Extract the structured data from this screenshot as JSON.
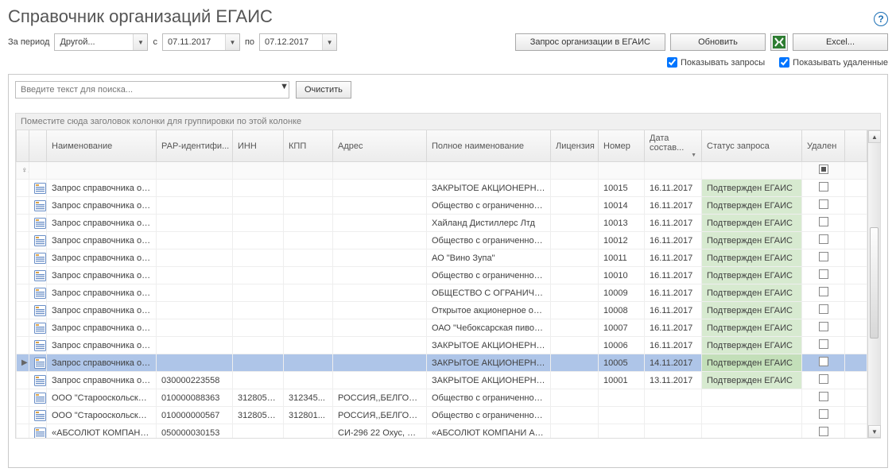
{
  "title": "Справочник организаций ЕГАИС",
  "period": {
    "label": "За период",
    "mode": "Другой...",
    "from_label": "с",
    "from": "07.11.2017",
    "to_label": "по",
    "to": "07.12.2017"
  },
  "buttons": {
    "request_org": "Запрос организации в ЕГАИС",
    "refresh": "Обновить",
    "excel": "Excel...",
    "clear": "Очистить"
  },
  "checks": {
    "show_requests": "Показывать запросы",
    "show_deleted": "Показывать удаленные"
  },
  "search_placeholder": "Введите текст для поиска...",
  "group_hint": "Поместите сюда заголовок колонки для группировки по этой колонке",
  "columns": {
    "name": "Наименование",
    "rar": "РАР-идентифи...",
    "inn": "ИНН",
    "kpp": "КПП",
    "address": "Адрес",
    "fullname": "Полное наименование",
    "license": "Лицензия",
    "number": "Номер",
    "date": "Дата состав...",
    "status": "Статус запроса",
    "deleted": "Удален"
  },
  "status_confirmed": "Подтвержден ЕГАИС",
  "rows": [
    {
      "sel": "",
      "name": "Запрос справочника ор...",
      "rar": "",
      "inn": "",
      "kpp": "",
      "addr": "",
      "full": "ЗАКРЫТОЕ АКЦИОНЕРНОЕ ...",
      "lic": "",
      "num": "10015",
      "date": "16.11.2017",
      "status": "ok",
      "del": false
    },
    {
      "sel": "",
      "name": "Запрос справочника ор...",
      "rar": "",
      "inn": "",
      "kpp": "",
      "addr": "",
      "full": "Общество с ограниченной о...",
      "lic": "",
      "num": "10014",
      "date": "16.11.2017",
      "status": "ok",
      "del": false
    },
    {
      "sel": "",
      "name": "Запрос справочника ор...",
      "rar": "",
      "inn": "",
      "kpp": "",
      "addr": "",
      "full": "Хайланд Дистиллерс Лтд",
      "lic": "",
      "num": "10013",
      "date": "16.11.2017",
      "status": "ok",
      "del": false
    },
    {
      "sel": "",
      "name": "Запрос справочника ор...",
      "rar": "",
      "inn": "",
      "kpp": "",
      "addr": "",
      "full": "Общество с ограниченной о...",
      "lic": "",
      "num": "10012",
      "date": "16.11.2017",
      "status": "ok",
      "del": false
    },
    {
      "sel": "",
      "name": "Запрос справочника ор...",
      "rar": "",
      "inn": "",
      "kpp": "",
      "addr": "",
      "full": "АО \"Вино Зупа\"",
      "lic": "",
      "num": "10011",
      "date": "16.11.2017",
      "status": "ok",
      "del": false
    },
    {
      "sel": "",
      "name": "Запрос справочника ор...",
      "rar": "",
      "inn": "",
      "kpp": "",
      "addr": "",
      "full": "Общество с ограниченной о...",
      "lic": "",
      "num": "10010",
      "date": "16.11.2017",
      "status": "ok",
      "del": false
    },
    {
      "sel": "",
      "name": "Запрос справочника ор...",
      "rar": "",
      "inn": "",
      "kpp": "",
      "addr": "",
      "full": "ОБЩЕСТВО С ОГРАНИЧЕНН...",
      "lic": "",
      "num": "10009",
      "date": "16.11.2017",
      "status": "ok",
      "del": false
    },
    {
      "sel": "",
      "name": "Запрос справочника ор...",
      "rar": "",
      "inn": "",
      "kpp": "",
      "addr": "",
      "full": "Открытое акционерное об...",
      "lic": "",
      "num": "10008",
      "date": "16.11.2017",
      "status": "ok",
      "del": false
    },
    {
      "sel": "",
      "name": "Запрос справочника ор...",
      "rar": "",
      "inn": "",
      "kpp": "",
      "addr": "",
      "full": "ОАО \"Чебоксарская пивова...",
      "lic": "",
      "num": "10007",
      "date": "16.11.2017",
      "status": "ok",
      "del": false
    },
    {
      "sel": "",
      "name": "Запрос справочника ор...",
      "rar": "",
      "inn": "",
      "kpp": "",
      "addr": "",
      "full": "ЗАКРЫТОЕ АКЦИОНЕРНОЕ ...",
      "lic": "",
      "num": "10006",
      "date": "16.11.2017",
      "status": "ok",
      "del": false
    },
    {
      "sel": "▶",
      "name": "Запрос справочника орг...",
      "rar": "",
      "inn": "",
      "kpp": "",
      "addr": "",
      "full": "ЗАКРЫТОЕ АКЦИОНЕРНОЕ ...",
      "lic": "",
      "num": "10005",
      "date": "14.11.2017",
      "status": "ok",
      "del": false,
      "selected": true
    },
    {
      "sel": "",
      "name": "Запрос справочника ор...",
      "rar": "030000223558",
      "inn": "",
      "kpp": "",
      "addr": "",
      "full": "ЗАКРЫТОЕ АКЦИОНЕРНОЕ ...",
      "lic": "",
      "num": "10001",
      "date": "13.11.2017",
      "status": "ok",
      "del": false
    },
    {
      "sel": "",
      "name": "ООО \"Старооскольский лике...",
      "rar": "010000088363",
      "inn": "3128053...",
      "kpp": "312345...",
      "addr": "РОССИЯ,,БЕЛГОРОД...",
      "full": "Общество с ограниченной о...",
      "lic": "",
      "num": "",
      "date": "",
      "status": "",
      "del": false
    },
    {
      "sel": "",
      "name": "ООО \"Старооскольский лике...",
      "rar": "010000000567",
      "inn": "3128053...",
      "kpp": "312801...",
      "addr": "РОССИЯ,,БЕЛГОРОД...",
      "full": "Общество с ограниченной о...",
      "lic": "",
      "num": "",
      "date": "",
      "status": "",
      "del": false
    },
    {
      "sel": "",
      "name": "«АБСОЛЮТ КОМПАНИ АВ»",
      "rar": "050000030153",
      "inn": "",
      "kpp": "",
      "addr": "СИ-296 22 Охус, Шв...",
      "full": "«АБСОЛЮТ КОМПАНИ АВ»",
      "lic": "",
      "num": "",
      "date": "",
      "status": "",
      "del": false
    }
  ]
}
